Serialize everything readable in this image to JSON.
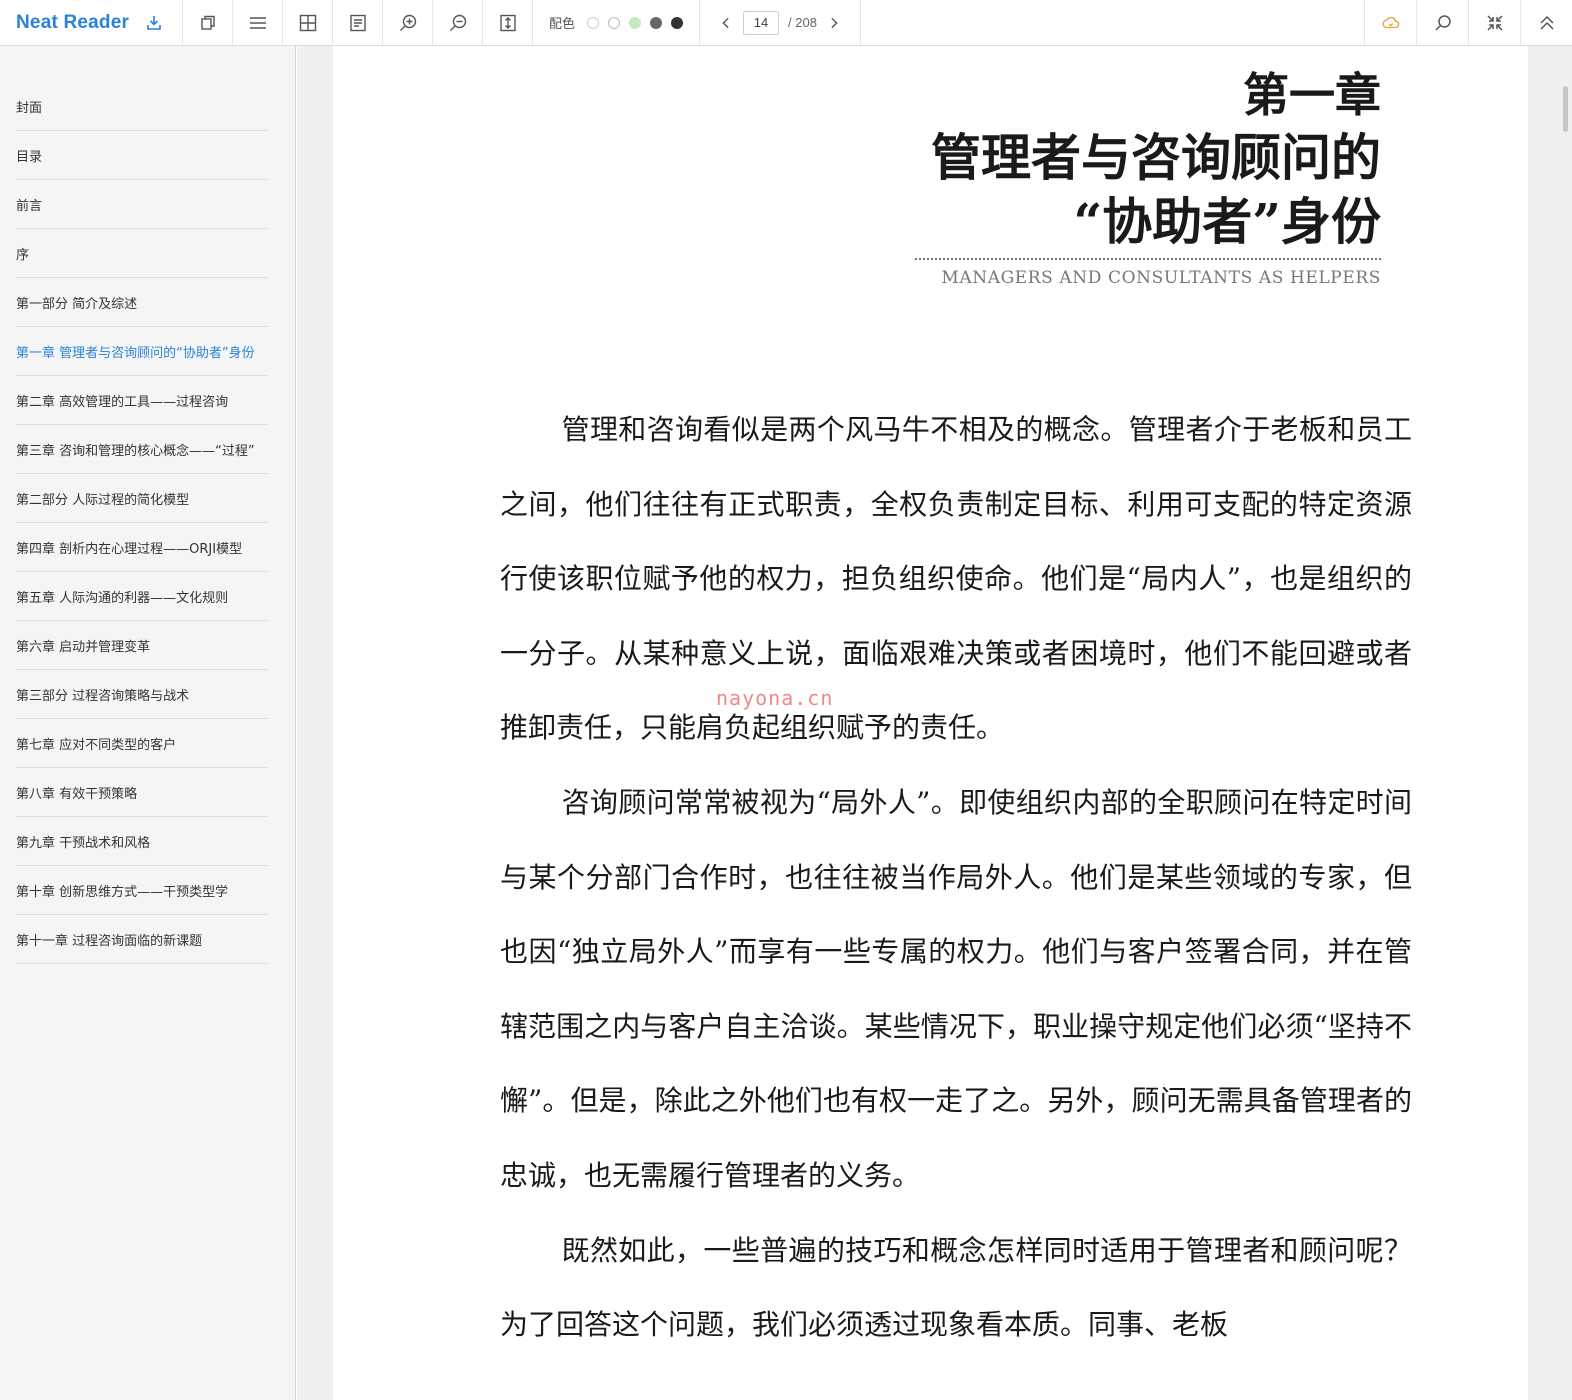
{
  "app": {
    "name": "Neat Reader"
  },
  "toolbar": {
    "theme_label": "配色",
    "theme_colors": [
      "#ffffff",
      "#ffffff",
      "#c8e8c4",
      "#666666",
      "#333333"
    ],
    "page_current": "14",
    "page_total": "/ 208",
    "icons": [
      "download-icon",
      "copy-icon",
      "menu-icon",
      "grid-icon",
      "notes-icon",
      "zoom-in-icon",
      "zoom-out-icon",
      "fit-page-icon",
      "prev-page-icon",
      "next-page-icon",
      "cloud-sync-icon",
      "search-icon",
      "collapse-icon",
      "scroll-top-icon"
    ]
  },
  "sidebar": {
    "items": [
      {
        "label": "封面"
      },
      {
        "label": "目录"
      },
      {
        "label": "前言"
      },
      {
        "label": "序"
      },
      {
        "label": "第一部分 简介及综述"
      },
      {
        "label": "第一章 管理者与咨询顾问的“协助者”身份",
        "active": true
      },
      {
        "label": "第二章 高效管理的工具——过程咨询"
      },
      {
        "label": "第三章 咨询和管理的核心概念——“过程”"
      },
      {
        "label": "第二部分 人际过程的简化模型"
      },
      {
        "label": "第四章 剖析内在心理过程——ORJI模型"
      },
      {
        "label": "第五章 人际沟通的利器——文化规则"
      },
      {
        "label": "第六章 启动并管理变革"
      },
      {
        "label": "第三部分 过程咨询策略与战术"
      },
      {
        "label": "第七章 应对不同类型的客户"
      },
      {
        "label": "第八章 有效干预策略"
      },
      {
        "label": "第九章 干预战术和风格"
      },
      {
        "label": "第十章 创新思维方式——干预类型学"
      },
      {
        "label": "第十一章 过程咨询面临的新课题"
      }
    ]
  },
  "content": {
    "chapter_number": "第一章",
    "title_line1": "管理者与咨询顾问的",
    "title_line2": "“协助者”身份",
    "subtitle_en": "MANAGERS AND CONSULTANTS AS HELPERS",
    "paragraphs": [
      "管理和咨询看似是两个风马牛不相及的概念。管理者介于老板和员工之间，他们往往有正式职责，全权负责制定目标、利用可支配的特定资源行使该职位赋予他的权力，担负组织使命。他们是“局内人”，也是组织的一分子。从某种意义上说，面临艰难决策或者困境时，他们不能回避或者推卸责任，只能肩负起组织赋予的责任。",
      "咨询顾问常常被视为“局外人”。即使组织内部的全职顾问在特定时间与某个分部门合作时，也往往被当作局外人。他们是某些领域的专家，但也因“独立局外人”而享有一些专属的权力。他们与客户签署合同，并在管辖范围之内与客户自主洽谈。某些情况下，职业操守规定他们必须“坚持不懈”。但是，除此之外他们也有权一走了之。另外，顾问无需具备管理者的忠诚，也无需履行管理者的义务。",
      "既然如此，一些普遍的技巧和概念怎样同时适用于管理者和顾问呢？为了回答这个问题，我们必须透过现象看本质。同事、老板"
    ],
    "watermark": "nayona.cn"
  }
}
